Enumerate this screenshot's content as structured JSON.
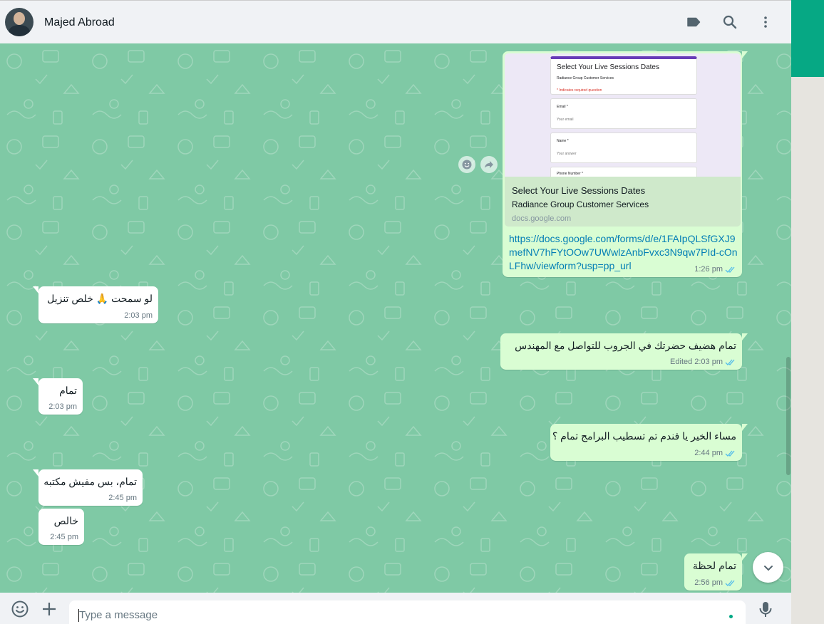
{
  "header": {
    "contact_name": "Majed Abroad"
  },
  "icons": {
    "label": "label-icon",
    "search": "search-icon",
    "menu": "more-vertical-icon",
    "emoji": "emoji-icon",
    "attach": "plus-icon",
    "mic": "microphone-icon",
    "scroll_down": "chevron-down-icon"
  },
  "colors": {
    "accent": "#00a884",
    "chat_background": "#7fc9a5",
    "outgoing_bubble": "#d9fdd3",
    "incoming_bubble": "#ffffff",
    "link": "#027eb5",
    "read_ticks": "#53bdeb"
  },
  "link_preview": {
    "thumbnail": {
      "form_title": "Select Your Live Sessions Dates",
      "form_subtitle": "Radiance Group Customer Services",
      "required_note": "* Indicates required question",
      "fields": [
        {
          "label": "Email *",
          "placeholder": "Your email"
        },
        {
          "label": "Name *",
          "placeholder": "Your answer"
        },
        {
          "label": "Phone Number *",
          "placeholder": ""
        }
      ]
    },
    "title": "Select Your Live Sessions Dates",
    "description": "Radiance Group Customer Services",
    "domain": "docs.google.com",
    "url": "https://docs.google.com/forms/d/e/1FAIpQLSfGXJ9mefNV7hFYtOOw7UWwlzAnbFvxc3N9qw7PId-cOnLFhw/viewform?usp=pp_url",
    "time": "1:26 pm"
  },
  "messages": [
    {
      "direction": "in",
      "text": "لو سمحت 🙏 خلص تنزيل",
      "time": "2:03 pm"
    },
    {
      "direction": "out",
      "text": "تمام هضيف  حضرتك في  الجروب للتواصل مع المهندس",
      "time": "2:03 pm",
      "status": "Edited"
    },
    {
      "direction": "in",
      "text": "تمام",
      "time": "2:03 pm"
    },
    {
      "direction": "out",
      "text": "مساء الخير يا فندم تم تسطيب البرامج تمام ؟",
      "time": "2:44 pm"
    },
    {
      "direction": "in",
      "text": "تمام، بس مفيش مكتبه",
      "time": "2:45 pm"
    },
    {
      "direction": "in",
      "text": "خالص",
      "time": "2:45 pm"
    },
    {
      "direction": "out",
      "text": "تمام لحظة",
      "time": "2:56 pm"
    }
  ],
  "composer": {
    "placeholder": "Type a message"
  }
}
